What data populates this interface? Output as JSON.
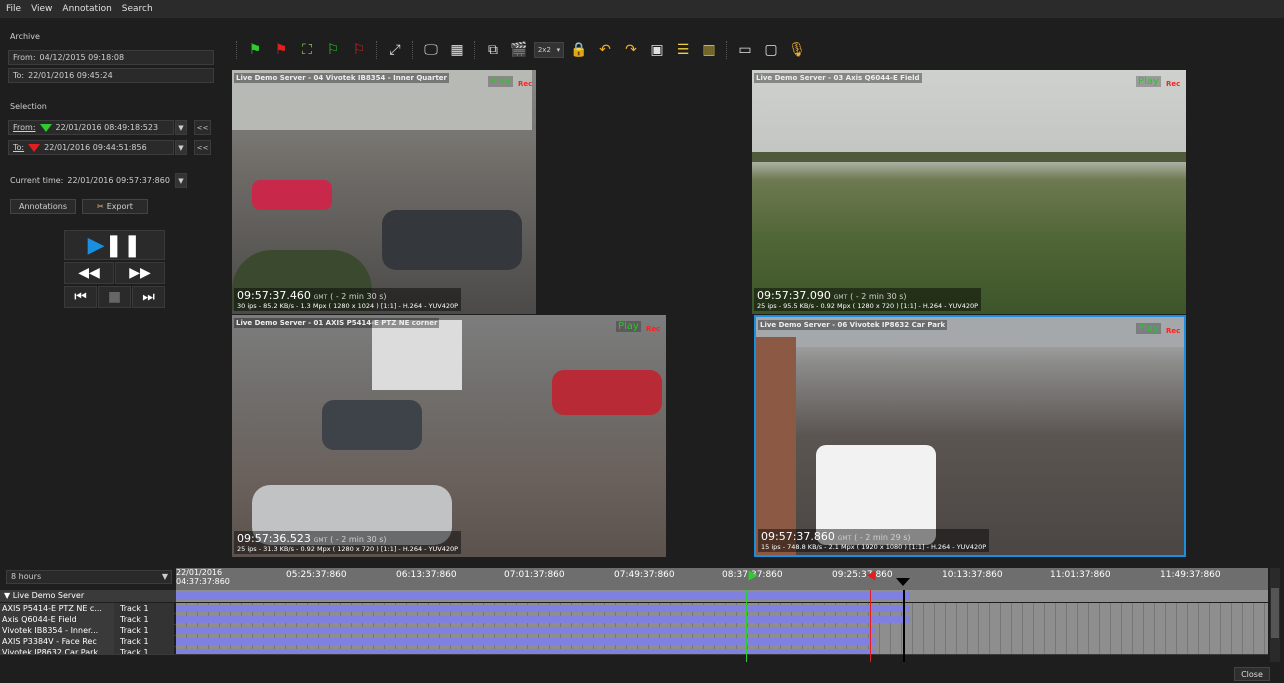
{
  "menu": [
    "File",
    "View",
    "Annotation",
    "Search"
  ],
  "archive": {
    "section_label": "Archive",
    "from_label": "From:",
    "from_value": "04/12/2015 09:18:08",
    "to_label": "To:",
    "to_value": "22/01/2016 09:45:24"
  },
  "selection": {
    "section_label": "Selection",
    "from_label": "From:",
    "from_value": "22/01/2016 08:49:18:523",
    "to_label": "To:",
    "to_value": "22/01/2016 09:44:51:856",
    "rewind_label": "<<"
  },
  "current_time": {
    "label": "Current time:",
    "value": "22/01/2016 09:57:37:860"
  },
  "buttons": {
    "annotations": "Annotations",
    "export": "Export"
  },
  "toolbar": {
    "layout_value": "2x2"
  },
  "cameras": [
    {
      "title": "Live Demo Server - 04 Vivotek IB8354 - Inner Quarter",
      "play": "Play",
      "rec": "Rec",
      "time": "09:57:37.460",
      "tz": "GMT",
      "offset": "( - 2 min 30 s)",
      "info": "30 ips - 85.2 KB/s - 1.3 Mpx ( 1280 x 1024 ) [1:1] - H.264 - YUV420P"
    },
    {
      "title": "Live Demo Server - 03 Axis Q6044-E Field",
      "play": "Play",
      "rec": "Rec",
      "time": "09:57:37.090",
      "tz": "GMT",
      "offset": "( - 2 min 30 s)",
      "info": "25 ips - 95.5 KB/s - 0.92 Mpx ( 1280 x 720 ) [1:1] - H.264 - YUV420P"
    },
    {
      "title": "Live Demo Server - 01 AXIS P5414-E PTZ NE corner",
      "play": "Play",
      "rec": "Rec",
      "time": "09:57:36.523",
      "tz": "GMT",
      "offset": "( - 2 min 30 s)",
      "info": "25 ips - 31.3 KB/s - 0.92 Mpx ( 1280 x 720 ) [1:1] - H.264 - YUV420P"
    },
    {
      "title": "Live Demo Server - 06 Vivotek IP8632 Car Park",
      "play": "Play",
      "rec": "Rec",
      "time": "09:57:37.860",
      "tz": "GMT",
      "offset": "( - 2 min 29 s)",
      "info": "15 ips - 748.8 KB/s - 2.1 Mpx ( 1920 x 1080 ) [1:1] - H.264 - YUV420P"
    }
  ],
  "timeline": {
    "range": "8 hours",
    "start_date": "22/01/2016",
    "start_time": "04:37:37:860",
    "ticks": [
      "05:25:37:860",
      "06:13:37:860",
      "07:01:37:860",
      "07:49:37:860",
      "08:37:37:860",
      "09:25:37:860",
      "10:13:37:860",
      "11:01:37:860",
      "11:49:37:860"
    ],
    "server": "Live Demo Server",
    "rows": [
      {
        "camera": "AXIS P5414-E PTZ NE c...",
        "track": "Track 1"
      },
      {
        "camera": "Axis Q6044-E Field",
        "track": "Track 1"
      },
      {
        "camera": "Vivotek IB8354 - Inner...",
        "track": "Track 1"
      },
      {
        "camera": "AXIS P3384V - Face Rec",
        "track": "Track 1"
      },
      {
        "camera": "Vivotek IP8632 Car Park",
        "track": "Track 1"
      }
    ],
    "close_label": "Close"
  },
  "colors": {
    "bg": "#1e1e1e",
    "accent_blue": "#1a8fe0",
    "play_green": "#22cc22",
    "rec_red": "#ff2020",
    "track_bar": "#8080e0"
  }
}
